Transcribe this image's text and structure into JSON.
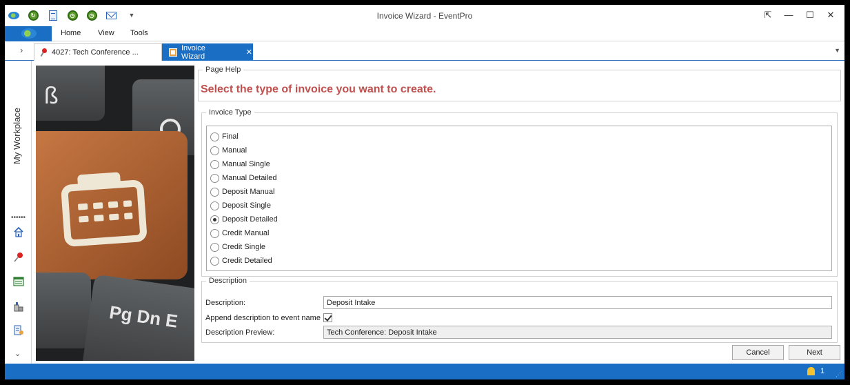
{
  "window": {
    "title": "Invoice Wizard - EventPro"
  },
  "ribbon": {
    "tabs": [
      "Home",
      "View",
      "Tools"
    ]
  },
  "doc_tabs": [
    {
      "label": "4027: Tech Conference ..."
    },
    {
      "label": "Invoice Wizard"
    }
  ],
  "sidebar": {
    "workplace_label": "My Workplace"
  },
  "page_help": {
    "legend": "Page Help",
    "text": "Select the type of invoice you want to create."
  },
  "invoice_type": {
    "legend": "Invoice Type",
    "options": [
      "Final",
      "Manual",
      "Manual Single",
      "Manual Detailed",
      "Deposit Manual",
      "Deposit Single",
      "Deposit Detailed",
      "Credit Manual",
      "Credit Single",
      "Credit Detailed"
    ],
    "selected": "Deposit Detailed"
  },
  "description": {
    "legend": "Description",
    "description_label": "Description:",
    "description_value": "Deposit Intake",
    "append_label": "Append description to event name",
    "append_checked": true,
    "preview_label": "Description Preview:",
    "preview_value": "Tech Conference: Deposit Intake"
  },
  "buttons": {
    "cancel": "Cancel",
    "next": "Next"
  },
  "statusbar": {
    "notification_count": "1"
  },
  "colors": {
    "accent": "#1a6fc4",
    "help_text": "#c0504d"
  }
}
